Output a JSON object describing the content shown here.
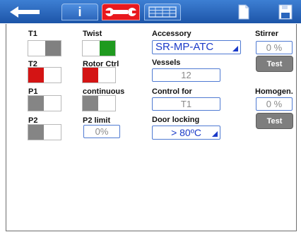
{
  "toolbar": {
    "tabs": [
      {
        "name": "back-icon"
      },
      {
        "name": "info-icon",
        "label": "i"
      },
      {
        "name": "wrench-icon",
        "active": true
      },
      {
        "name": "grid-icon"
      },
      {
        "name": "document-icon"
      },
      {
        "name": "save-icon"
      }
    ]
  },
  "left": {
    "t1_label": "T1",
    "t2_label": "T2",
    "p1_label": "P1",
    "p2_label": "P2"
  },
  "middle": {
    "twist_label": "Twist",
    "rotor_label": "Rotor Ctrl",
    "continuous_label": "continuous",
    "p2limit_label": "P2 limit",
    "p2limit_value": "0%"
  },
  "right": {
    "accessory_label": "Accessory",
    "accessory_value": "SR-MP-ATC",
    "vessels_label": "Vessels",
    "vessels_value": "12",
    "control_label": "Control for",
    "control_value": "T1",
    "door_label": "Door locking",
    "door_value": "> 80ºC"
  },
  "far_right": {
    "stirrer_label": "Stirrer",
    "stirrer_value": "0 %",
    "stirrer_test": "Test",
    "homogen_label": "Homogen.",
    "homogen_value": "0 %",
    "homogen_test": "Test"
  },
  "colors": {
    "topbar": "#2a66bd",
    "active_tab": "#e8191e",
    "toggle_red": "#d41414",
    "toggle_green": "#1f9a1f"
  }
}
